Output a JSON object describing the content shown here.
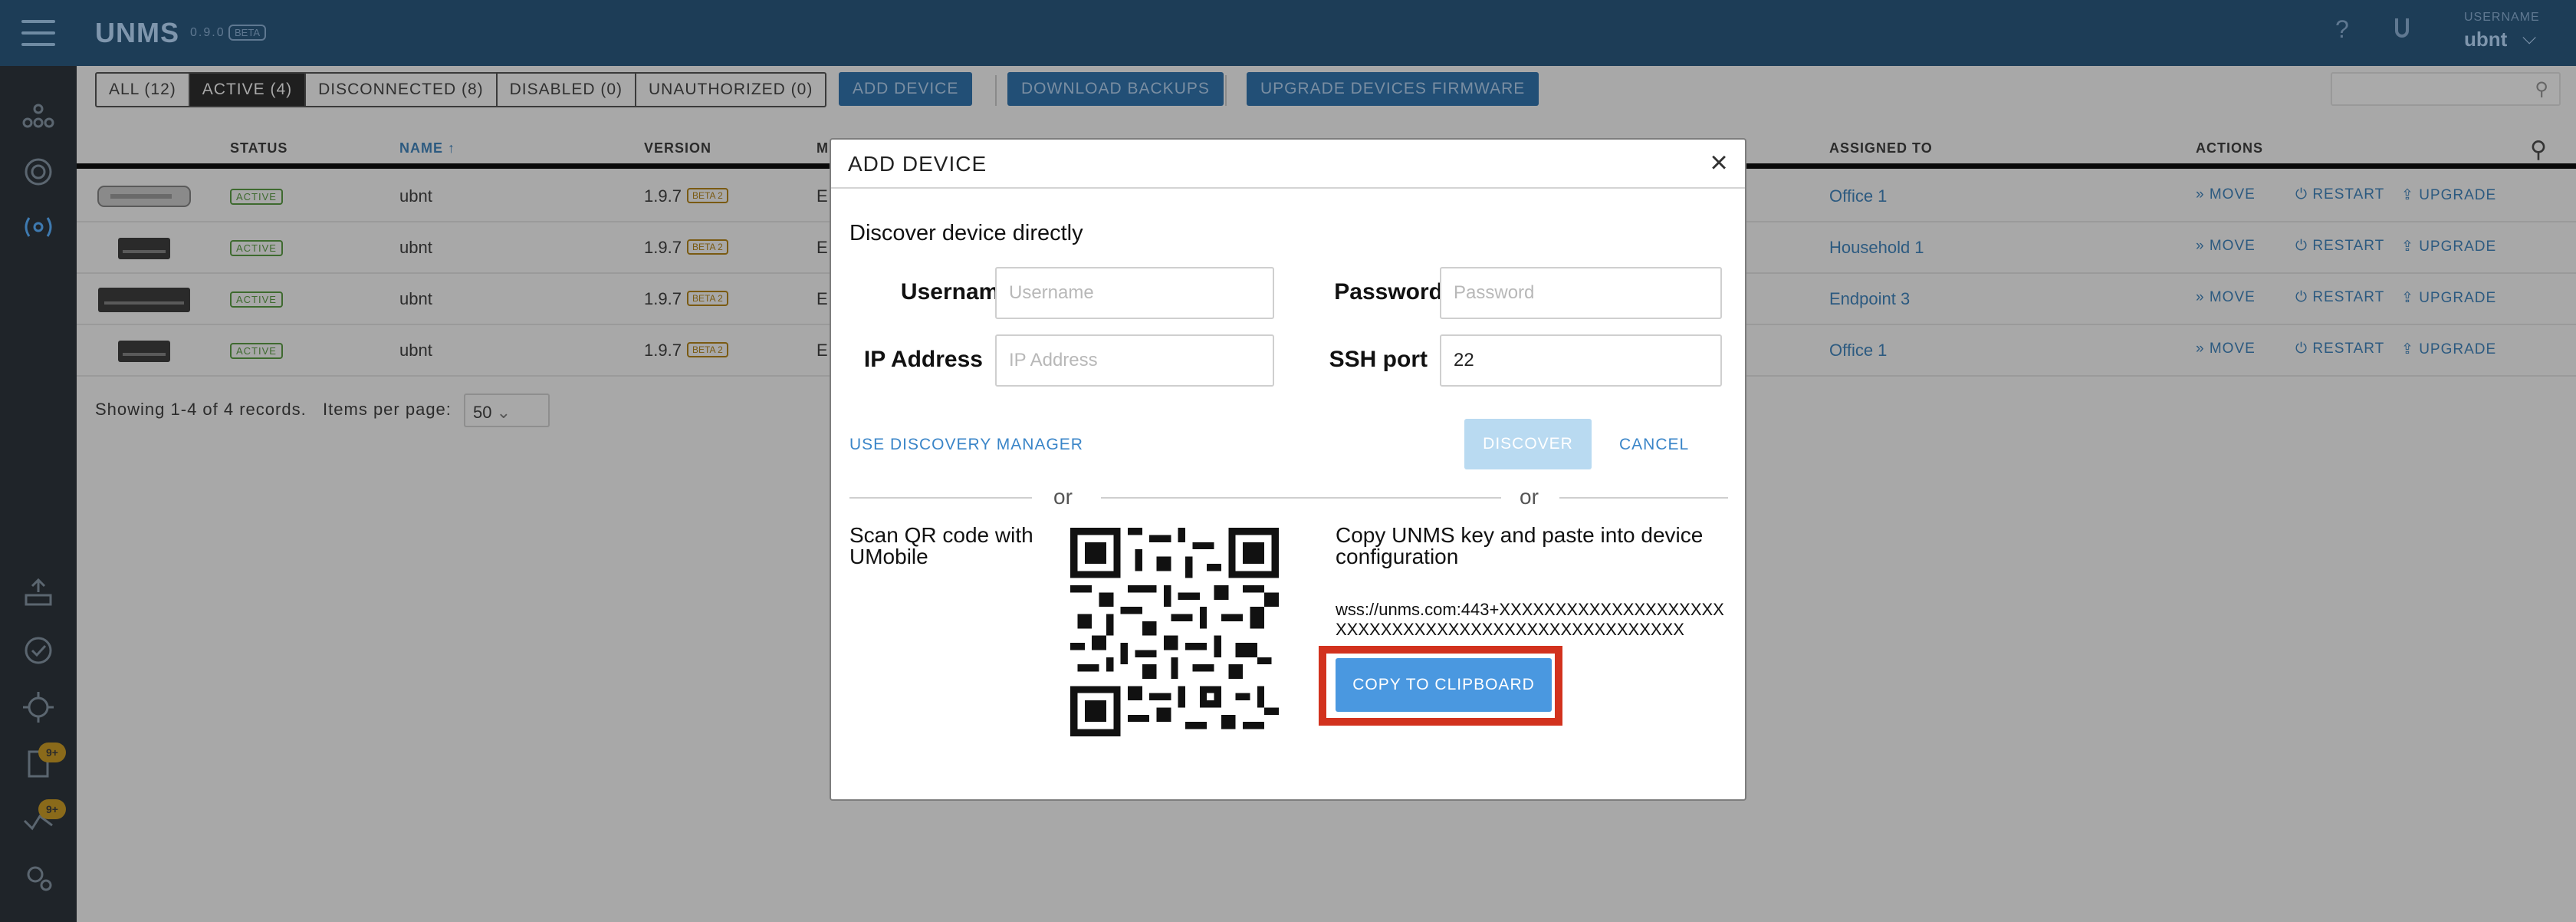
{
  "topbar": {
    "brand": "UNMS",
    "version": "0.9.0",
    "beta": "BETA",
    "help": "?",
    "user_caption": "USERNAME",
    "user_name": "ubnt",
    "user_chevron": "⌵"
  },
  "filters": [
    {
      "label": "ALL (12)"
    },
    {
      "label": "ACTIVE (4)"
    },
    {
      "label": "DISCONNECTED (8)"
    },
    {
      "label": "DISABLED (0)"
    },
    {
      "label": "UNAUTHORIZED (0)"
    }
  ],
  "toolbar": {
    "add_device": "ADD DEVICE",
    "download_backups": "DOWNLOAD BACKUPS",
    "upgrade_firmware": "UPGRADE DEVICES FIRMWARE"
  },
  "table": {
    "headers": {
      "status": "STATUS",
      "name": "NAME ↑",
      "version": "VERSION",
      "model": "M",
      "assigned": "ASSIGNED TO",
      "actions": "ACTIONS"
    },
    "rows": [
      {
        "status": "ACTIVE",
        "name": "ubnt",
        "version": "1.9.7",
        "beta": "BETA 2",
        "model": "E",
        "assigned": "Office 1"
      },
      {
        "status": "ACTIVE",
        "name": "ubnt",
        "version": "1.9.7",
        "beta": "BETA 2",
        "model": "E",
        "assigned": "Household 1"
      },
      {
        "status": "ACTIVE",
        "name": "ubnt",
        "version": "1.9.7",
        "beta": "BETA 2",
        "model": "E",
        "assigned": "Endpoint 3"
      },
      {
        "status": "ACTIVE",
        "name": "ubnt",
        "version": "1.9.7",
        "beta": "BETA 2",
        "model": "E",
        "assigned": "Office 1"
      }
    ],
    "actions": {
      "move": "MOVE",
      "restart": "RESTART",
      "upgrade": "UPGRADE"
    }
  },
  "footer": {
    "records": "Showing 1-4 of 4 records.",
    "items_per_page_label": "Items per page:",
    "items_per_page_value": "50"
  },
  "sidebar": {
    "badge_1": "9+",
    "badge_2": "9+"
  },
  "modal": {
    "title": "ADD DEVICE",
    "close": "×",
    "section_title": "Discover device directly",
    "username_label": "Username",
    "username_placeholder": "Username",
    "password_label": "Password",
    "password_placeholder": "Password",
    "ip_label": "IP Address",
    "ip_placeholder": "IP Address",
    "ssh_label": "SSH port",
    "ssh_value": "22",
    "discovery_manager": "USE DISCOVERY MANAGER",
    "discover": "DISCOVER",
    "cancel": "CANCEL",
    "or": "or",
    "qr_caption": "Scan QR code with UMobile",
    "key_caption": "Copy UNMS key and paste into device configuration",
    "key": "wss://unms.com:443+XXXXXXXXXXXXXXXXXXXXXXXXXXXXXXXXXXXXXXXXXXXXXXXXXXX",
    "copy": "COPY TO CLIPBOARD"
  },
  "colors": {
    "topbar": "#1d3d57",
    "sidebar": "#1f2429",
    "accent": "#4a98e0",
    "highlight": "#d2321e"
  }
}
